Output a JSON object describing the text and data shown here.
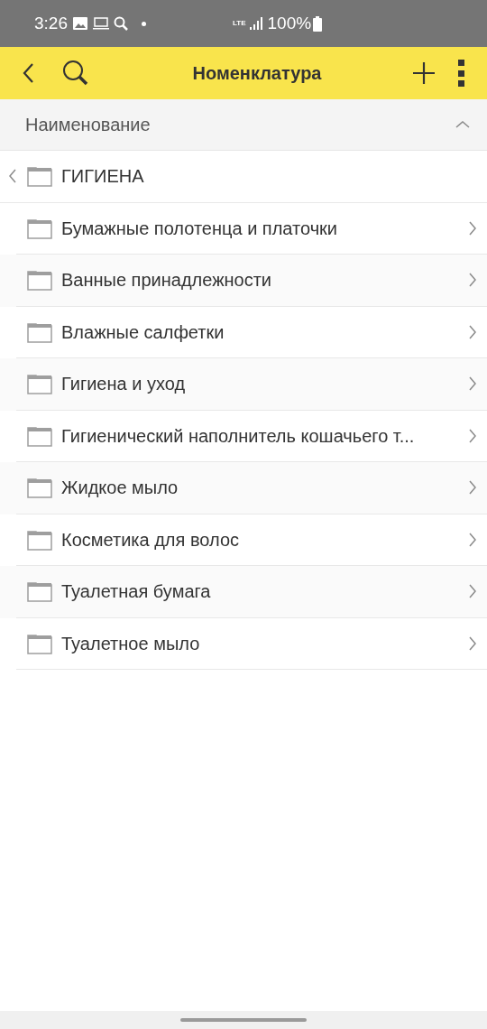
{
  "status_bar": {
    "time": "3:26",
    "network": "LTE",
    "battery": "100%"
  },
  "header": {
    "title": "Номенклатура"
  },
  "column_header": {
    "label": "Наименование"
  },
  "parent_folder": {
    "label": "ГИГИЕНА"
  },
  "folders": [
    {
      "label": "Бумажные полотенца и платочки"
    },
    {
      "label": "Ванные принадлежности"
    },
    {
      "label": "Влажные салфетки"
    },
    {
      "label": "Гигиена и уход"
    },
    {
      "label": "Гигиенический наполнитель кошачьего т..."
    },
    {
      "label": "Жидкое мыло"
    },
    {
      "label": "Косметика для волос"
    },
    {
      "label": "Туалетная бумага"
    },
    {
      "label": "Туалетное мыло"
    }
  ]
}
